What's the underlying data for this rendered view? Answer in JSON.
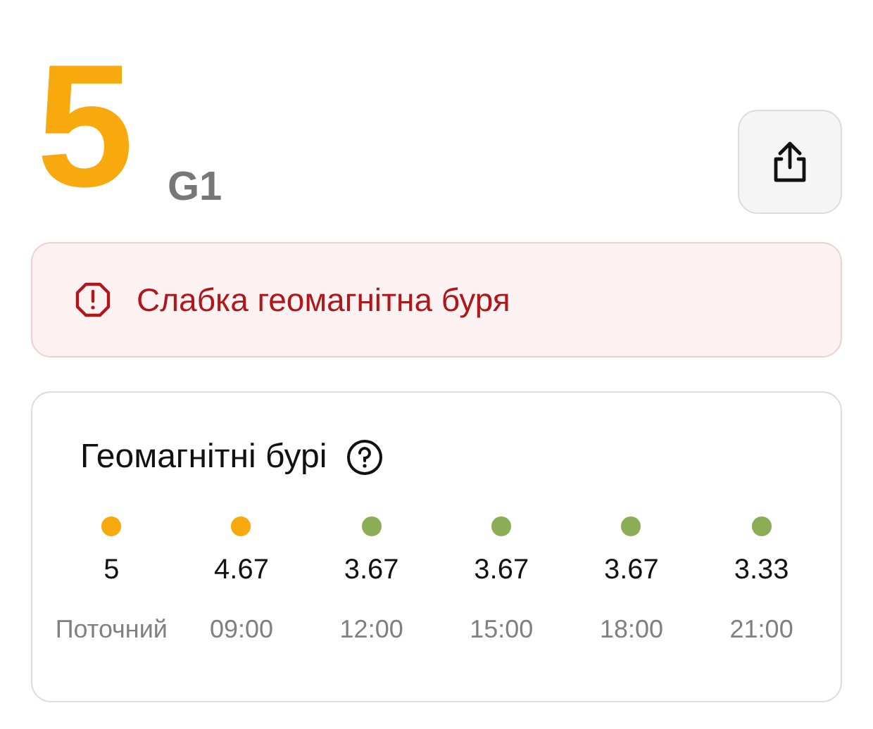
{
  "kp": {
    "value": "5",
    "scale": "G1",
    "color": "#f8a90d"
  },
  "share_button": {
    "kind": "share"
  },
  "alert": {
    "text": "Слабка геомагнітна буря"
  },
  "forecast": {
    "title": "Геомагнітні бурі",
    "slots": [
      {
        "value": "5",
        "time": "Поточний",
        "color": "#f8a90d"
      },
      {
        "value": "4.67",
        "time": "09:00",
        "color": "#f8a90d"
      },
      {
        "value": "3.67",
        "time": "12:00",
        "color": "#8bad55"
      },
      {
        "value": "3.67",
        "time": "15:00",
        "color": "#8bad55"
      },
      {
        "value": "3.67",
        "time": "18:00",
        "color": "#8bad55"
      },
      {
        "value": "3.33",
        "time": "21:00",
        "color": "#8bad55"
      }
    ]
  }
}
